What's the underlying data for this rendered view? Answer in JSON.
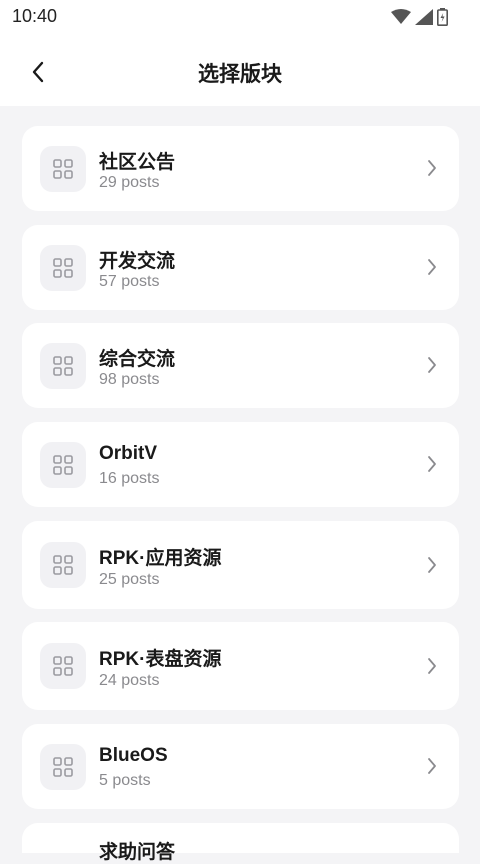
{
  "status_bar": {
    "time": "10:40"
  },
  "header": {
    "title": "选择版块"
  },
  "boards": [
    {
      "name": "社区公告",
      "posts": "29 posts"
    },
    {
      "name": "开发交流",
      "posts": "57 posts"
    },
    {
      "name": "综合交流",
      "posts": "98 posts"
    },
    {
      "name": "OrbitV",
      "posts": "16 posts"
    },
    {
      "name": "RPK·应用资源",
      "posts": "25 posts"
    },
    {
      "name": "RPK·表盘资源",
      "posts": "24 posts"
    },
    {
      "name": "BlueOS",
      "posts": "5 posts"
    },
    {
      "name": "求助问答",
      "posts": ""
    }
  ],
  "colors": {
    "background": "#f4f4f6",
    "card": "#ffffff",
    "icon_bg": "#f1f1f4",
    "subtext": "#8a8a8e"
  }
}
